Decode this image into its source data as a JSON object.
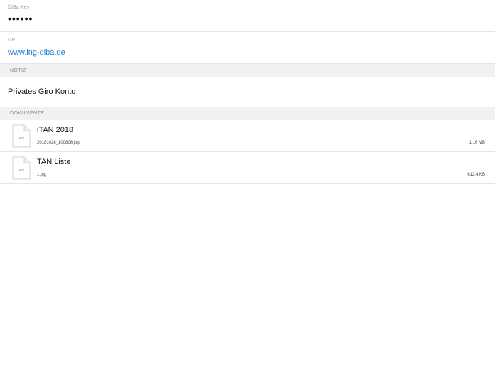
{
  "fields": {
    "key": {
      "label": "DiBa Key",
      "value": "••••••"
    },
    "url": {
      "label": "URL",
      "value": "www.ing-diba.de"
    }
  },
  "sections": {
    "notiz": {
      "header": "NOTIZ",
      "text": "Privates Giro Konto"
    },
    "dokumente": {
      "header": "DOKUMENTE",
      "items": [
        {
          "title": "iTAN 2018",
          "filename": "20181028_100806.jpg",
          "size": "1.16 MB",
          "icon": "jpg-file-icon",
          "icon_label": "JPG"
        },
        {
          "title": "TAN Liste",
          "filename": "1.jpg",
          "size": "612.4 KB",
          "icon": "jpg-file-icon",
          "icon_label": "JPG"
        }
      ]
    }
  },
  "colors": {
    "link": "#1e7fd6",
    "section_bg": "#f1f1f3",
    "label": "#9a9a9a"
  }
}
